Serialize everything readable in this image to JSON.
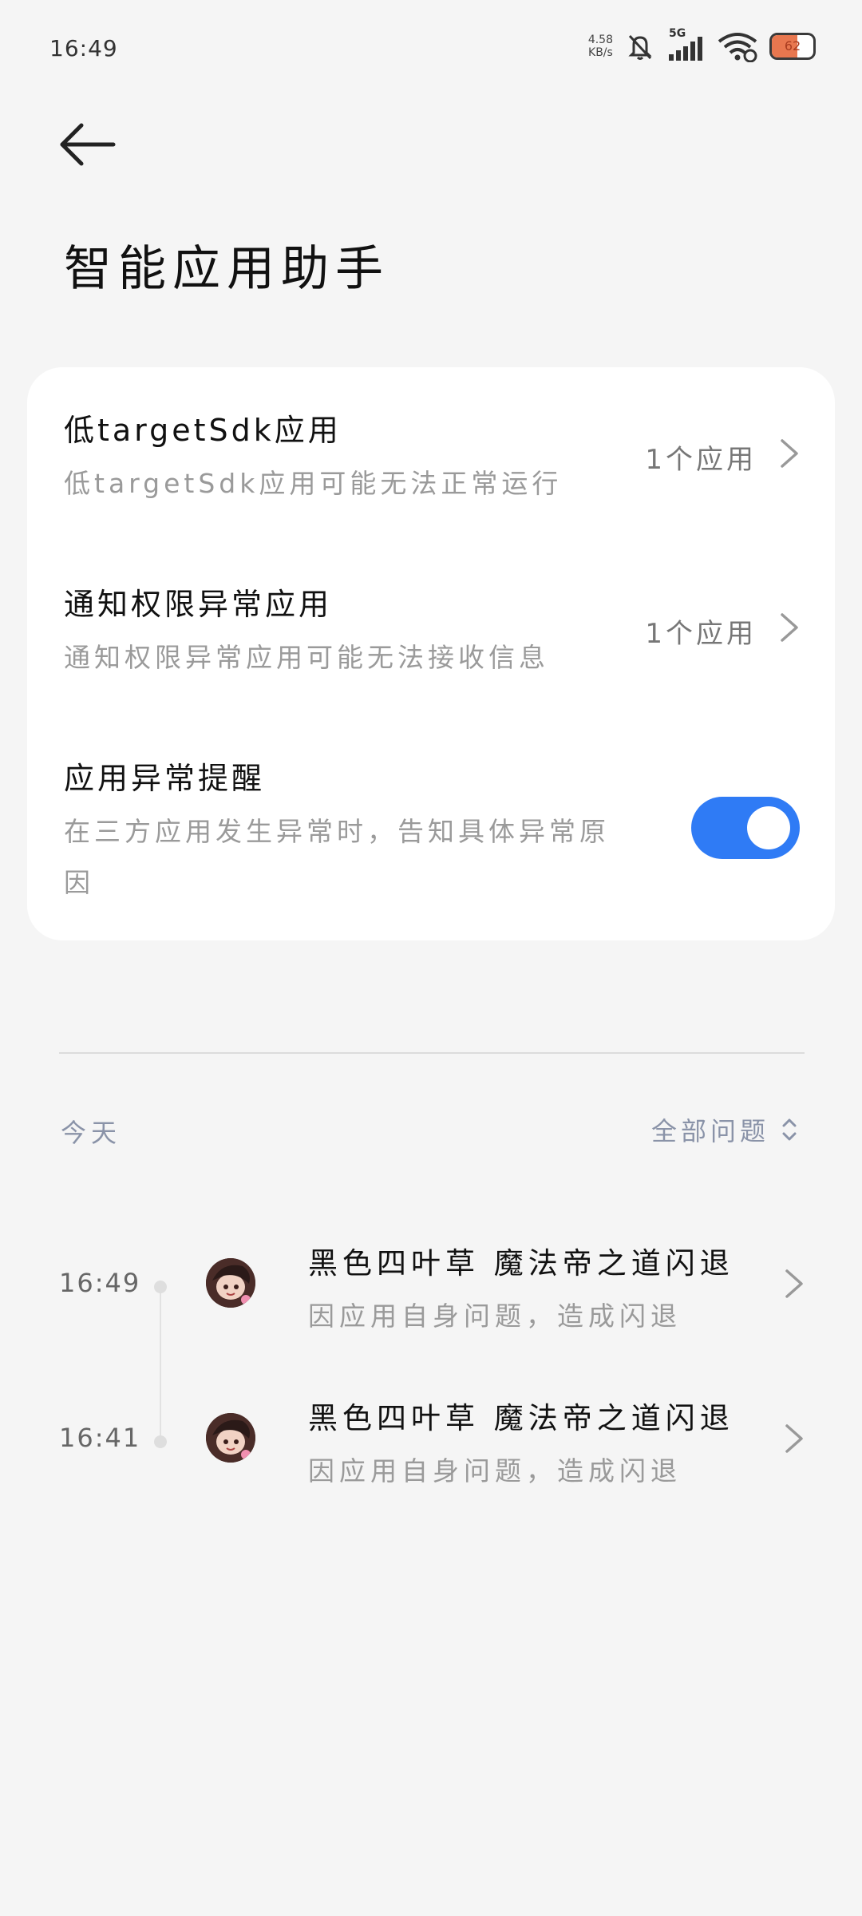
{
  "status_bar": {
    "time": "16:49",
    "net_speed_value": "4.58",
    "net_speed_unit": "KB/s",
    "network_type": "5G",
    "battery_level": "62",
    "icons": [
      "mute-bell-icon",
      "signal-icon",
      "wifi-icon",
      "battery-icon"
    ]
  },
  "header": {
    "back_icon": "arrow-left-icon",
    "title": "智能应用助手"
  },
  "settings": [
    {
      "title": "低targetSdk应用",
      "subtitle": "低targetSdk应用可能无法正常运行",
      "value": "1个应用",
      "control": "chevron"
    },
    {
      "title": "通知权限异常应用",
      "subtitle": "通知权限异常应用可能无法接收信息",
      "value": "1个应用",
      "control": "chevron"
    },
    {
      "title": "应用异常提醒",
      "subtitle_line1": "在三方应用发生异常时，告知具体异常原",
      "subtitle_line2": "因",
      "control": "toggle",
      "enabled": true
    }
  ],
  "history": {
    "section_label": "今天",
    "filter_label": "全部问题",
    "events": [
      {
        "time": "16:49",
        "title": "黑色四叶草 魔法帝之道闪退",
        "subtitle": "因应用自身问题，造成闪退"
      },
      {
        "time": "16:41",
        "title": "黑色四叶草 魔法帝之道闪退",
        "subtitle": "因应用自身问题，造成闪退"
      }
    ]
  },
  "colors": {
    "background": "#f5f5f5",
    "card": "#ffffff",
    "accent": "#2f7bf5",
    "secondary_text": "#9a9a9a",
    "filter_text": "#8a93a8"
  }
}
